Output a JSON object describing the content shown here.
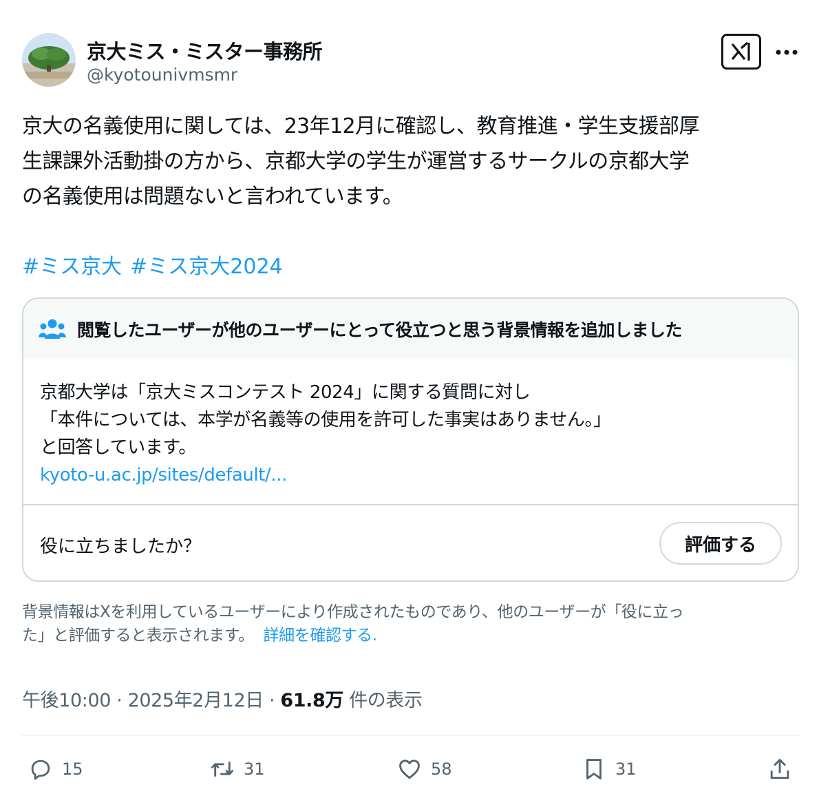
{
  "author": {
    "name": "京大ミス・ミスター事務所",
    "handle": "@kyotounivmsmr"
  },
  "tweet": {
    "lines": [
      "京大の名義使用に関しては、23年12月に確認し、教育推進・学生支援部厚",
      "生課課外活動掛の方から、京都大学の学生が運営するサークルの京都大学",
      "の名義使用は問題ないと言われています。"
    ],
    "hashtags": [
      "#ミス京大",
      "#ミス京大2024"
    ]
  },
  "community_note": {
    "header": "閲覧したユーザーが他のユーザーにとって役立つと思う背景情報を追加しました",
    "body_lines": [
      "京都大学は「京大ミスコンテスト 2024」に関する質問に対し",
      "「本件については、本学が名義等の使用を許可した事実はありません。」",
      "と回答しています。"
    ],
    "link": "kyoto-u.ac.jp/sites/default/...",
    "helpful_question": "役に立ちましたか？",
    "rate_button": "評価する"
  },
  "disclaimer": {
    "line1": "背景情報はXを利用しているユーザーにより作成されたものであり、他のユーザーが「役に立っ",
    "line2": "た」と評価すると表示されます。",
    "link": "詳細を確認する",
    "period": "."
  },
  "meta": {
    "time": "午後10:00",
    "dot1": " · ",
    "date": "2025年2月12日",
    "dot2": " · ",
    "views": "61.8万",
    "views_label": " 件の表示"
  },
  "actions": {
    "replies": "15",
    "reposts": "31",
    "likes": "58",
    "bookmarks": "31"
  },
  "icons": {
    "grok": "grok-icon",
    "more": "more-icon",
    "note": "people-icon",
    "reply": "reply-icon",
    "repost": "repost-icon",
    "like": "heart-icon",
    "bookmark": "bookmark-icon",
    "share": "share-icon"
  },
  "colors": {
    "link": "#1d9bf0",
    "secondary_text": "#536471",
    "border": "#cfd9de"
  }
}
